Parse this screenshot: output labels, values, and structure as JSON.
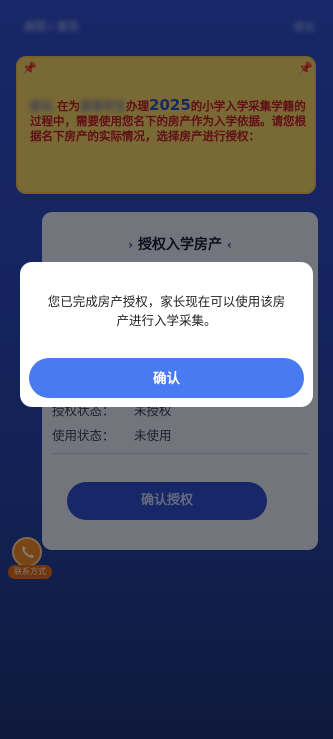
{
  "topbar": {
    "left_text": "返回 / 首页",
    "right_text": "退出"
  },
  "notice": {
    "blurred_name": "家长",
    "t1": "在为",
    "blurred_child": "某某学生",
    "t2": "办理",
    "year": "2025",
    "t3": "的小学入学采集学籍的过程中，需要使用您名下的房产作为入学依据。请您根据名下房产的实际情况，选择房产进行授权："
  },
  "card": {
    "title": "授权入学房产",
    "rows": [
      {
        "key": "授权状态：",
        "value": "未授权"
      },
      {
        "key": "使用状态：",
        "value": "未使用"
      }
    ],
    "confirm_button": "确认授权"
  },
  "contact": {
    "label": "联系方式"
  },
  "modal": {
    "message": "您已完成房产授权，家长现在可以使用该房产进行入学采集。",
    "button": "确认"
  },
  "colors": {
    "accent": "#4a7af0",
    "notice_bg": "#f1d36b",
    "notice_text": "#c0202c",
    "page_bg": "#2a49bf"
  }
}
